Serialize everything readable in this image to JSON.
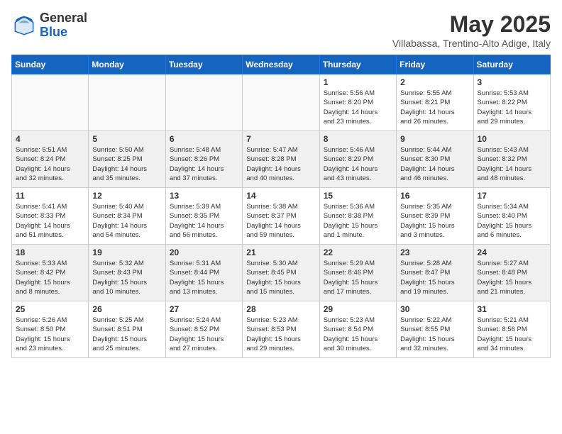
{
  "header": {
    "logo_general": "General",
    "logo_blue": "Blue",
    "title": "May 2025",
    "subtitle": "Villabassa, Trentino-Alto Adige, Italy"
  },
  "days_of_week": [
    "Sunday",
    "Monday",
    "Tuesday",
    "Wednesday",
    "Thursday",
    "Friday",
    "Saturday"
  ],
  "weeks": [
    [
      {
        "day": "",
        "info": ""
      },
      {
        "day": "",
        "info": ""
      },
      {
        "day": "",
        "info": ""
      },
      {
        "day": "",
        "info": ""
      },
      {
        "day": "1",
        "info": "Sunrise: 5:56 AM\nSunset: 8:20 PM\nDaylight: 14 hours\nand 23 minutes."
      },
      {
        "day": "2",
        "info": "Sunrise: 5:55 AM\nSunset: 8:21 PM\nDaylight: 14 hours\nand 26 minutes."
      },
      {
        "day": "3",
        "info": "Sunrise: 5:53 AM\nSunset: 8:22 PM\nDaylight: 14 hours\nand 29 minutes."
      }
    ],
    [
      {
        "day": "4",
        "info": "Sunrise: 5:51 AM\nSunset: 8:24 PM\nDaylight: 14 hours\nand 32 minutes."
      },
      {
        "day": "5",
        "info": "Sunrise: 5:50 AM\nSunset: 8:25 PM\nDaylight: 14 hours\nand 35 minutes."
      },
      {
        "day": "6",
        "info": "Sunrise: 5:48 AM\nSunset: 8:26 PM\nDaylight: 14 hours\nand 37 minutes."
      },
      {
        "day": "7",
        "info": "Sunrise: 5:47 AM\nSunset: 8:28 PM\nDaylight: 14 hours\nand 40 minutes."
      },
      {
        "day": "8",
        "info": "Sunrise: 5:46 AM\nSunset: 8:29 PM\nDaylight: 14 hours\nand 43 minutes."
      },
      {
        "day": "9",
        "info": "Sunrise: 5:44 AM\nSunset: 8:30 PM\nDaylight: 14 hours\nand 46 minutes."
      },
      {
        "day": "10",
        "info": "Sunrise: 5:43 AM\nSunset: 8:32 PM\nDaylight: 14 hours\nand 48 minutes."
      }
    ],
    [
      {
        "day": "11",
        "info": "Sunrise: 5:41 AM\nSunset: 8:33 PM\nDaylight: 14 hours\nand 51 minutes."
      },
      {
        "day": "12",
        "info": "Sunrise: 5:40 AM\nSunset: 8:34 PM\nDaylight: 14 hours\nand 54 minutes."
      },
      {
        "day": "13",
        "info": "Sunrise: 5:39 AM\nSunset: 8:35 PM\nDaylight: 14 hours\nand 56 minutes."
      },
      {
        "day": "14",
        "info": "Sunrise: 5:38 AM\nSunset: 8:37 PM\nDaylight: 14 hours\nand 59 minutes."
      },
      {
        "day": "15",
        "info": "Sunrise: 5:36 AM\nSunset: 8:38 PM\nDaylight: 15 hours\nand 1 minute."
      },
      {
        "day": "16",
        "info": "Sunrise: 5:35 AM\nSunset: 8:39 PM\nDaylight: 15 hours\nand 3 minutes."
      },
      {
        "day": "17",
        "info": "Sunrise: 5:34 AM\nSunset: 8:40 PM\nDaylight: 15 hours\nand 6 minutes."
      }
    ],
    [
      {
        "day": "18",
        "info": "Sunrise: 5:33 AM\nSunset: 8:42 PM\nDaylight: 15 hours\nand 8 minutes."
      },
      {
        "day": "19",
        "info": "Sunrise: 5:32 AM\nSunset: 8:43 PM\nDaylight: 15 hours\nand 10 minutes."
      },
      {
        "day": "20",
        "info": "Sunrise: 5:31 AM\nSunset: 8:44 PM\nDaylight: 15 hours\nand 13 minutes."
      },
      {
        "day": "21",
        "info": "Sunrise: 5:30 AM\nSunset: 8:45 PM\nDaylight: 15 hours\nand 15 minutes."
      },
      {
        "day": "22",
        "info": "Sunrise: 5:29 AM\nSunset: 8:46 PM\nDaylight: 15 hours\nand 17 minutes."
      },
      {
        "day": "23",
        "info": "Sunrise: 5:28 AM\nSunset: 8:47 PM\nDaylight: 15 hours\nand 19 minutes."
      },
      {
        "day": "24",
        "info": "Sunrise: 5:27 AM\nSunset: 8:48 PM\nDaylight: 15 hours\nand 21 minutes."
      }
    ],
    [
      {
        "day": "25",
        "info": "Sunrise: 5:26 AM\nSunset: 8:50 PM\nDaylight: 15 hours\nand 23 minutes."
      },
      {
        "day": "26",
        "info": "Sunrise: 5:25 AM\nSunset: 8:51 PM\nDaylight: 15 hours\nand 25 minutes."
      },
      {
        "day": "27",
        "info": "Sunrise: 5:24 AM\nSunset: 8:52 PM\nDaylight: 15 hours\nand 27 minutes."
      },
      {
        "day": "28",
        "info": "Sunrise: 5:23 AM\nSunset: 8:53 PM\nDaylight: 15 hours\nand 29 minutes."
      },
      {
        "day": "29",
        "info": "Sunrise: 5:23 AM\nSunset: 8:54 PM\nDaylight: 15 hours\nand 30 minutes."
      },
      {
        "day": "30",
        "info": "Sunrise: 5:22 AM\nSunset: 8:55 PM\nDaylight: 15 hours\nand 32 minutes."
      },
      {
        "day": "31",
        "info": "Sunrise: 5:21 AM\nSunset: 8:56 PM\nDaylight: 15 hours\nand 34 minutes."
      }
    ]
  ]
}
